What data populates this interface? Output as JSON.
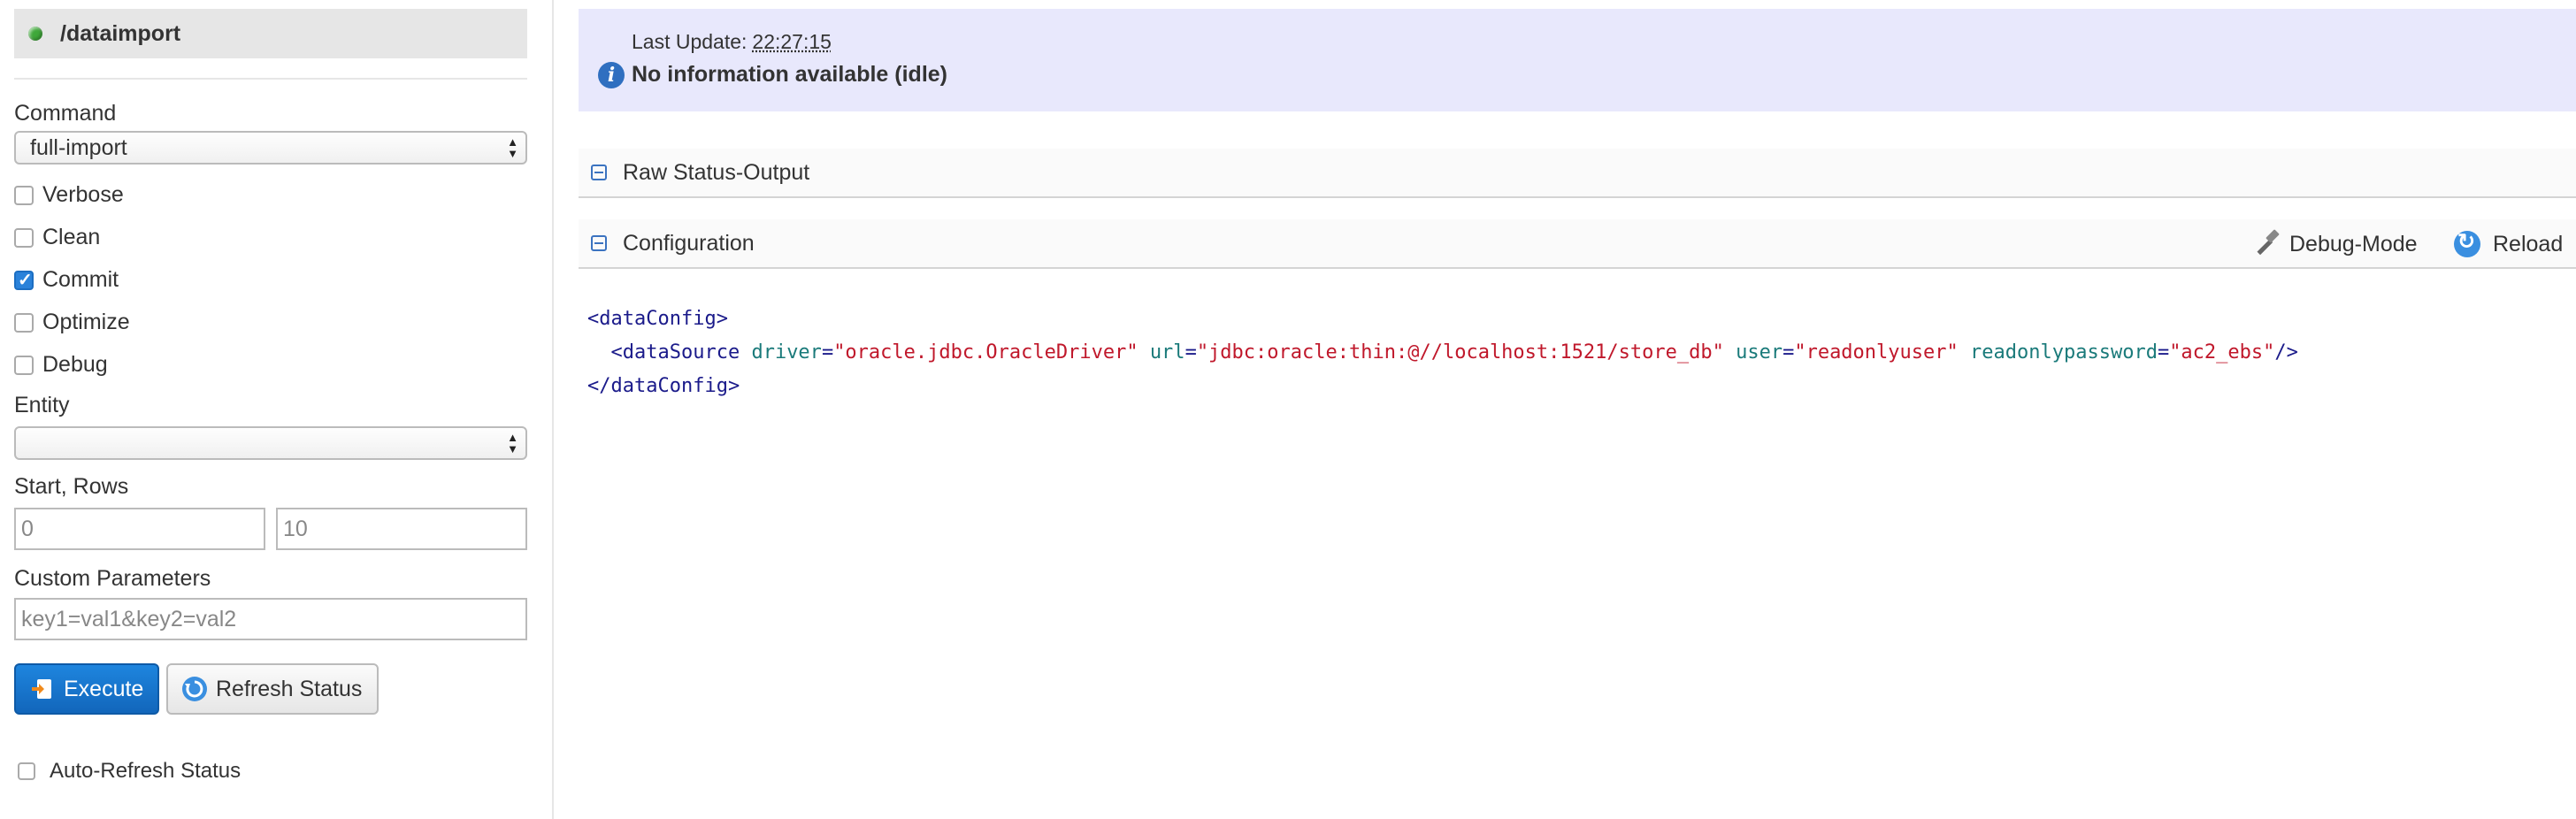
{
  "handler": {
    "name": "/dataimport",
    "status_color": "#3fa83a"
  },
  "form": {
    "command_label": "Command",
    "command_value": "full-import",
    "checkboxes": [
      {
        "label": "Verbose",
        "checked": false
      },
      {
        "label": "Clean",
        "checked": false
      },
      {
        "label": "Commit",
        "checked": true
      },
      {
        "label": "Optimize",
        "checked": false
      },
      {
        "label": "Debug",
        "checked": false
      }
    ],
    "entity_label": "Entity",
    "entity_value": "",
    "start_rows_label": "Start, Rows",
    "start_value": "0",
    "rows_value": "10",
    "custom_params_label": "Custom Parameters",
    "custom_params_placeholder": "key1=val1&key2=val2",
    "execute_label": "Execute",
    "refresh_label": "Refresh Status",
    "auto_refresh_label": "Auto-Refresh Status"
  },
  "status": {
    "last_update_label": "Last Update:",
    "last_update_time": "22:27:15",
    "message": "No information available (idle)",
    "background": "#e8e8fc"
  },
  "sections": {
    "raw_title": "Raw Status-Output",
    "config_title": "Configuration",
    "debug_mode_label": "Debug-Mode",
    "reload_label": "Reload"
  },
  "config_code": {
    "open_tag": "<dataConfig>",
    "ds_tag_open": "<dataSource",
    "attrs": [
      {
        "name": "driver",
        "value": "\"oracle.jdbc.OracleDriver\""
      },
      {
        "name": "url",
        "value": "\"jdbc:oracle:thin:@//localhost:1521/store_db\""
      },
      {
        "name": "user",
        "value": "\"readonlyuser\""
      },
      {
        "name": "readonlypassword",
        "value": "\"ac2_ebs\""
      }
    ],
    "ds_tag_close": "/>",
    "close_tag": "</dataConfig>"
  },
  "colors": {
    "accent": "#1e85de",
    "tag": "#1a1a8a",
    "attr": "#1a7a7a",
    "value": "#c0182b"
  }
}
